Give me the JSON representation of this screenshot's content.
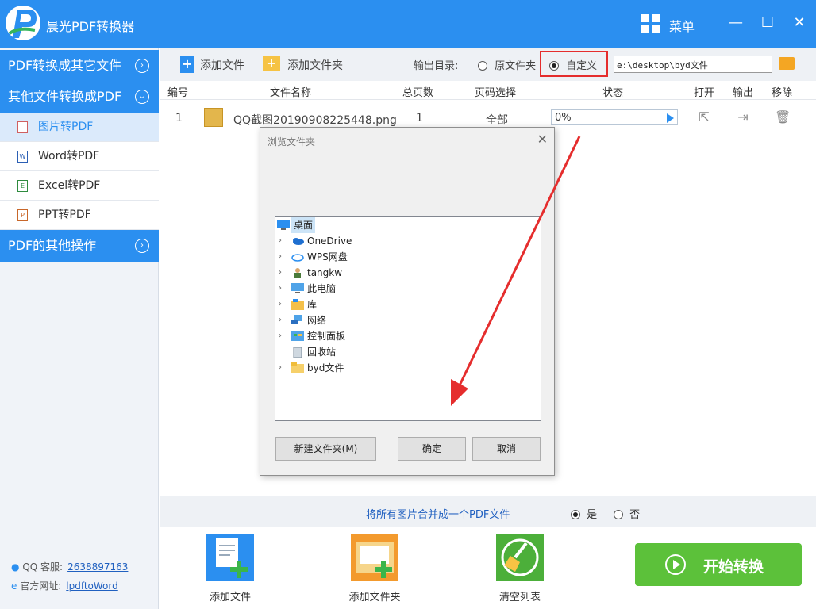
{
  "app": {
    "title": "晨光PDF转换器",
    "menu_label": "菜单"
  },
  "window": {
    "minimize": "—",
    "maximize": "☐",
    "close": "✕"
  },
  "sidebar": {
    "group1": "PDF转换成其它文件",
    "group2": "其他文件转换成PDF",
    "items": [
      {
        "label": "图片转PDF",
        "icon": "image-file-icon"
      },
      {
        "label": "Word转PDF",
        "icon": "word-file-icon"
      },
      {
        "label": "Excel转PDF",
        "icon": "excel-file-icon"
      },
      {
        "label": "PPT转PDF",
        "icon": "ppt-file-icon"
      }
    ],
    "group3": "PDF的其他操作",
    "qq_label": "QQ 客服:",
    "qq_value": "2638897163",
    "site_label": "官方网址:",
    "site_value": "lpdftoWord"
  },
  "toolbar": {
    "add_file": "添加文件",
    "add_folder": "添加文件夹",
    "output_label": "输出目录:",
    "opt_original": "原文件夹",
    "opt_custom": "自定义",
    "path_value": "e:\\desktop\\byd文件"
  },
  "table": {
    "headers": [
      "编号",
      "文件名称",
      "总页数",
      "页码选择",
      "状态",
      "打开",
      "输出",
      "移除"
    ],
    "rows": [
      {
        "index": "1",
        "name": "QQ截图20190908225448.png",
        "pages": "1",
        "range": "全部",
        "progress": "0%"
      }
    ]
  },
  "merge": {
    "text": "将所有图片合并成一个PDF文件",
    "yes": "是",
    "no": "否"
  },
  "bottom": {
    "add_file": "添加文件",
    "add_folder": "添加文件夹",
    "clear": "清空列表",
    "start": "开始转换"
  },
  "dialog": {
    "title": "浏览文件夹",
    "tree": [
      {
        "label": "桌面",
        "icon": "desktop-icon",
        "expandable": false
      },
      {
        "label": "OneDrive",
        "icon": "onedrive-icon",
        "expandable": true
      },
      {
        "label": "WPS网盘",
        "icon": "cloud-icon",
        "expandable": true
      },
      {
        "label": "tangkw",
        "icon": "user-icon",
        "expandable": true
      },
      {
        "label": "此电脑",
        "icon": "computer-icon",
        "expandable": true
      },
      {
        "label": "库",
        "icon": "library-icon",
        "expandable": true
      },
      {
        "label": "网络",
        "icon": "network-icon",
        "expandable": true
      },
      {
        "label": "控制面板",
        "icon": "control-panel-icon",
        "expandable": true
      },
      {
        "label": "回收站",
        "icon": "recycle-bin-icon",
        "expandable": false
      },
      {
        "label": "byd文件",
        "icon": "folder-icon",
        "expandable": true
      }
    ],
    "new_folder": "新建文件夹(M)",
    "ok": "确定",
    "cancel": "取消"
  },
  "colors": {
    "brand": "#2b8ff0",
    "start": "#5cc13a",
    "annotation": "#e52d2d"
  }
}
